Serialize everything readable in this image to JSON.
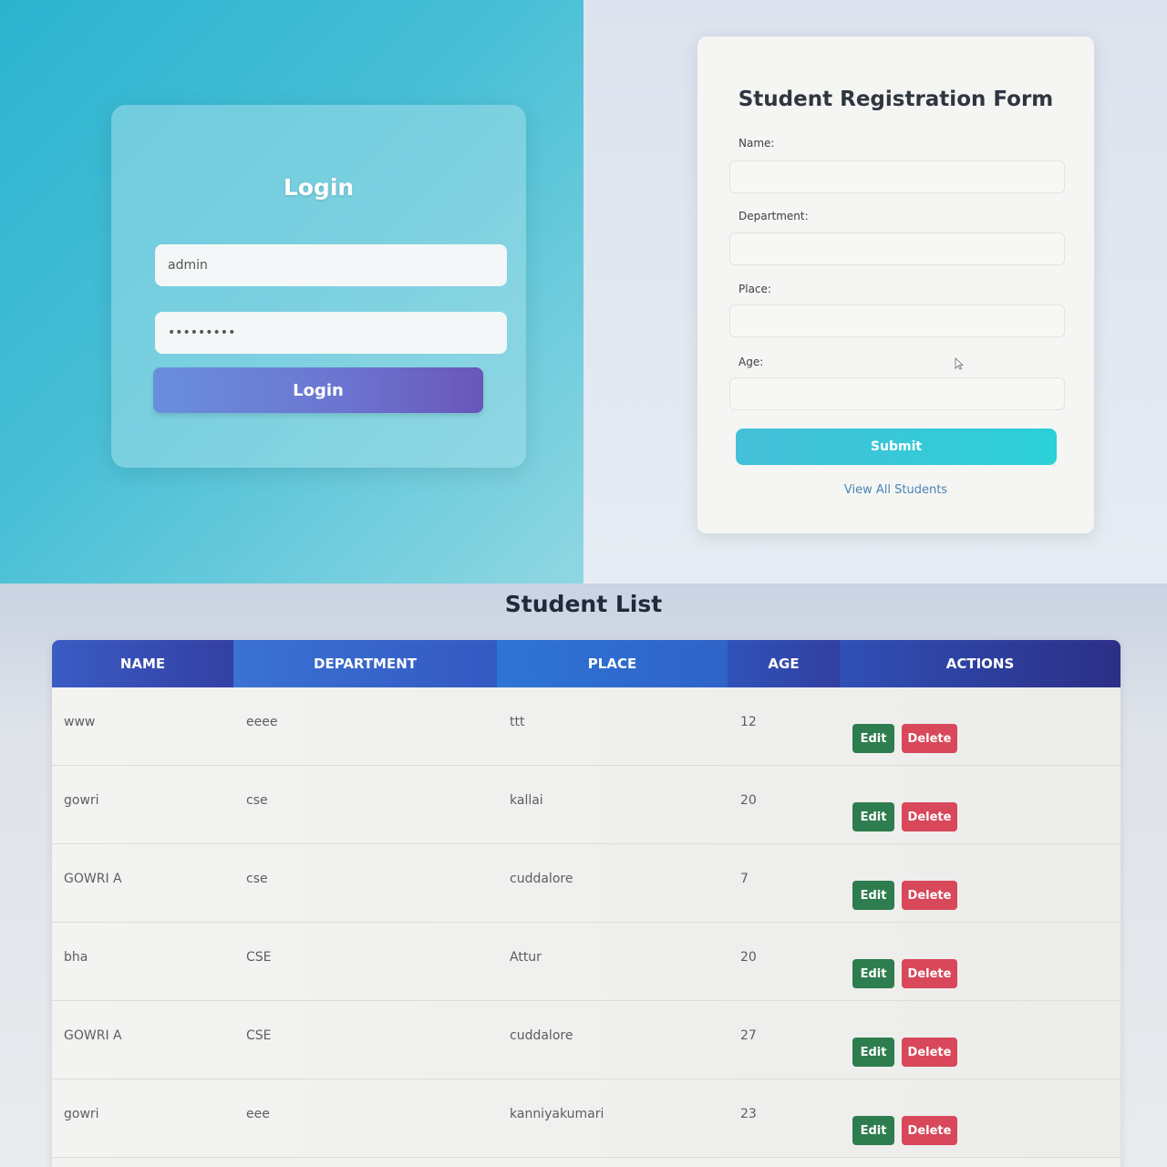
{
  "login": {
    "title": "Login",
    "username_value": "admin",
    "password_value": "•••••••••",
    "button_label": "Login"
  },
  "registration": {
    "title": "Student Registration Form",
    "fields": [
      {
        "label": "Name:"
      },
      {
        "label": "Department:"
      },
      {
        "label": "Place:"
      },
      {
        "label": "Age:"
      }
    ],
    "submit_label": "Submit",
    "view_all_link": "View All Students"
  },
  "student_list": {
    "title": "Student List",
    "columns": [
      "NAME",
      "DEPARTMENT",
      "PLACE",
      "AGE",
      "ACTIONS"
    ],
    "rows": [
      {
        "name": "www",
        "department": "eeee",
        "place": "ttt",
        "age": "12"
      },
      {
        "name": "gowri",
        "department": "cse",
        "place": "kallai",
        "age": "20"
      },
      {
        "name": "GOWRI A",
        "department": "cse",
        "place": "cuddalore",
        "age": "7"
      },
      {
        "name": "bha",
        "department": "CSE",
        "place": "Attur",
        "age": "20"
      },
      {
        "name": "GOWRI A",
        "department": "CSE",
        "place": "cuddalore",
        "age": "27"
      },
      {
        "name": "gowri",
        "department": "eee",
        "place": "kanniyakumari",
        "age": "23"
      }
    ],
    "edit_label": "Edit",
    "delete_label": "Delete"
  },
  "colors": {
    "login_bg": "#2bb3cf",
    "login_button": "#6b73cf",
    "submit_button": "#2bd0d8",
    "table_header": "#3459c2",
    "edit_button": "#2e7d4f",
    "delete_button": "#d8475a"
  }
}
